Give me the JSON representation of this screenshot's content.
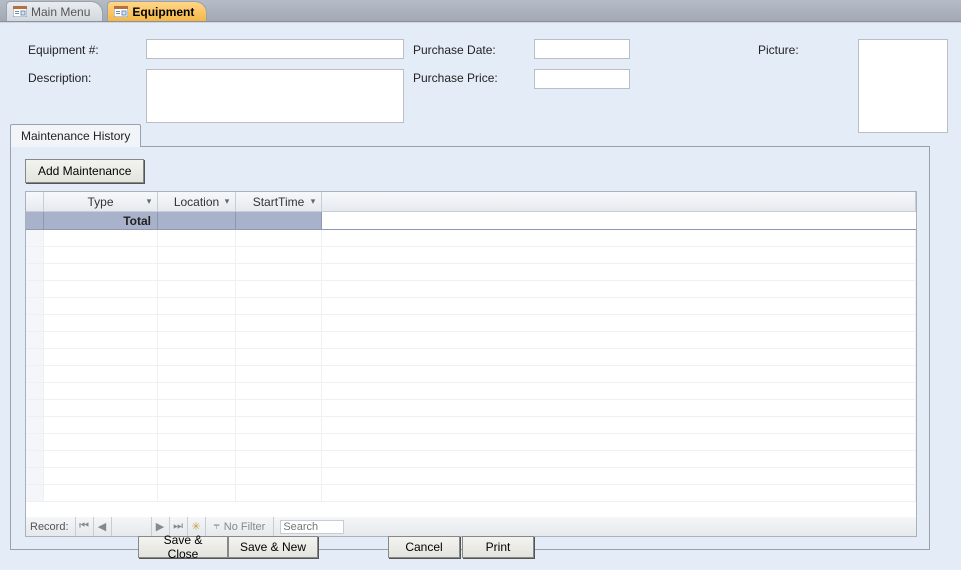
{
  "tabs": {
    "main_menu": "Main Menu",
    "equipment": "Equipment"
  },
  "header": {
    "equipment_num_label": "Equipment #:",
    "equipment_num_value": "",
    "description_label": "Description:",
    "description_value": "",
    "purchase_date_label": "Purchase Date:",
    "purchase_date_value": "",
    "purchase_price_label": "Purchase Price:",
    "purchase_price_value": "",
    "picture_label": "Picture:"
  },
  "inner_tab": {
    "maintenance_history": "Maintenance History",
    "add_maintenance": "Add Maintenance"
  },
  "grid": {
    "columns": {
      "type": "Type",
      "location": "Location",
      "start_time": "StartTime"
    },
    "total_label": "Total"
  },
  "record_nav": {
    "label": "Record:",
    "no_filter": "No Filter",
    "search_placeholder": "Search"
  },
  "buttons": {
    "save_close": "Save & Close",
    "save_new": "Save & New",
    "cancel": "Cancel",
    "print": "Print"
  }
}
